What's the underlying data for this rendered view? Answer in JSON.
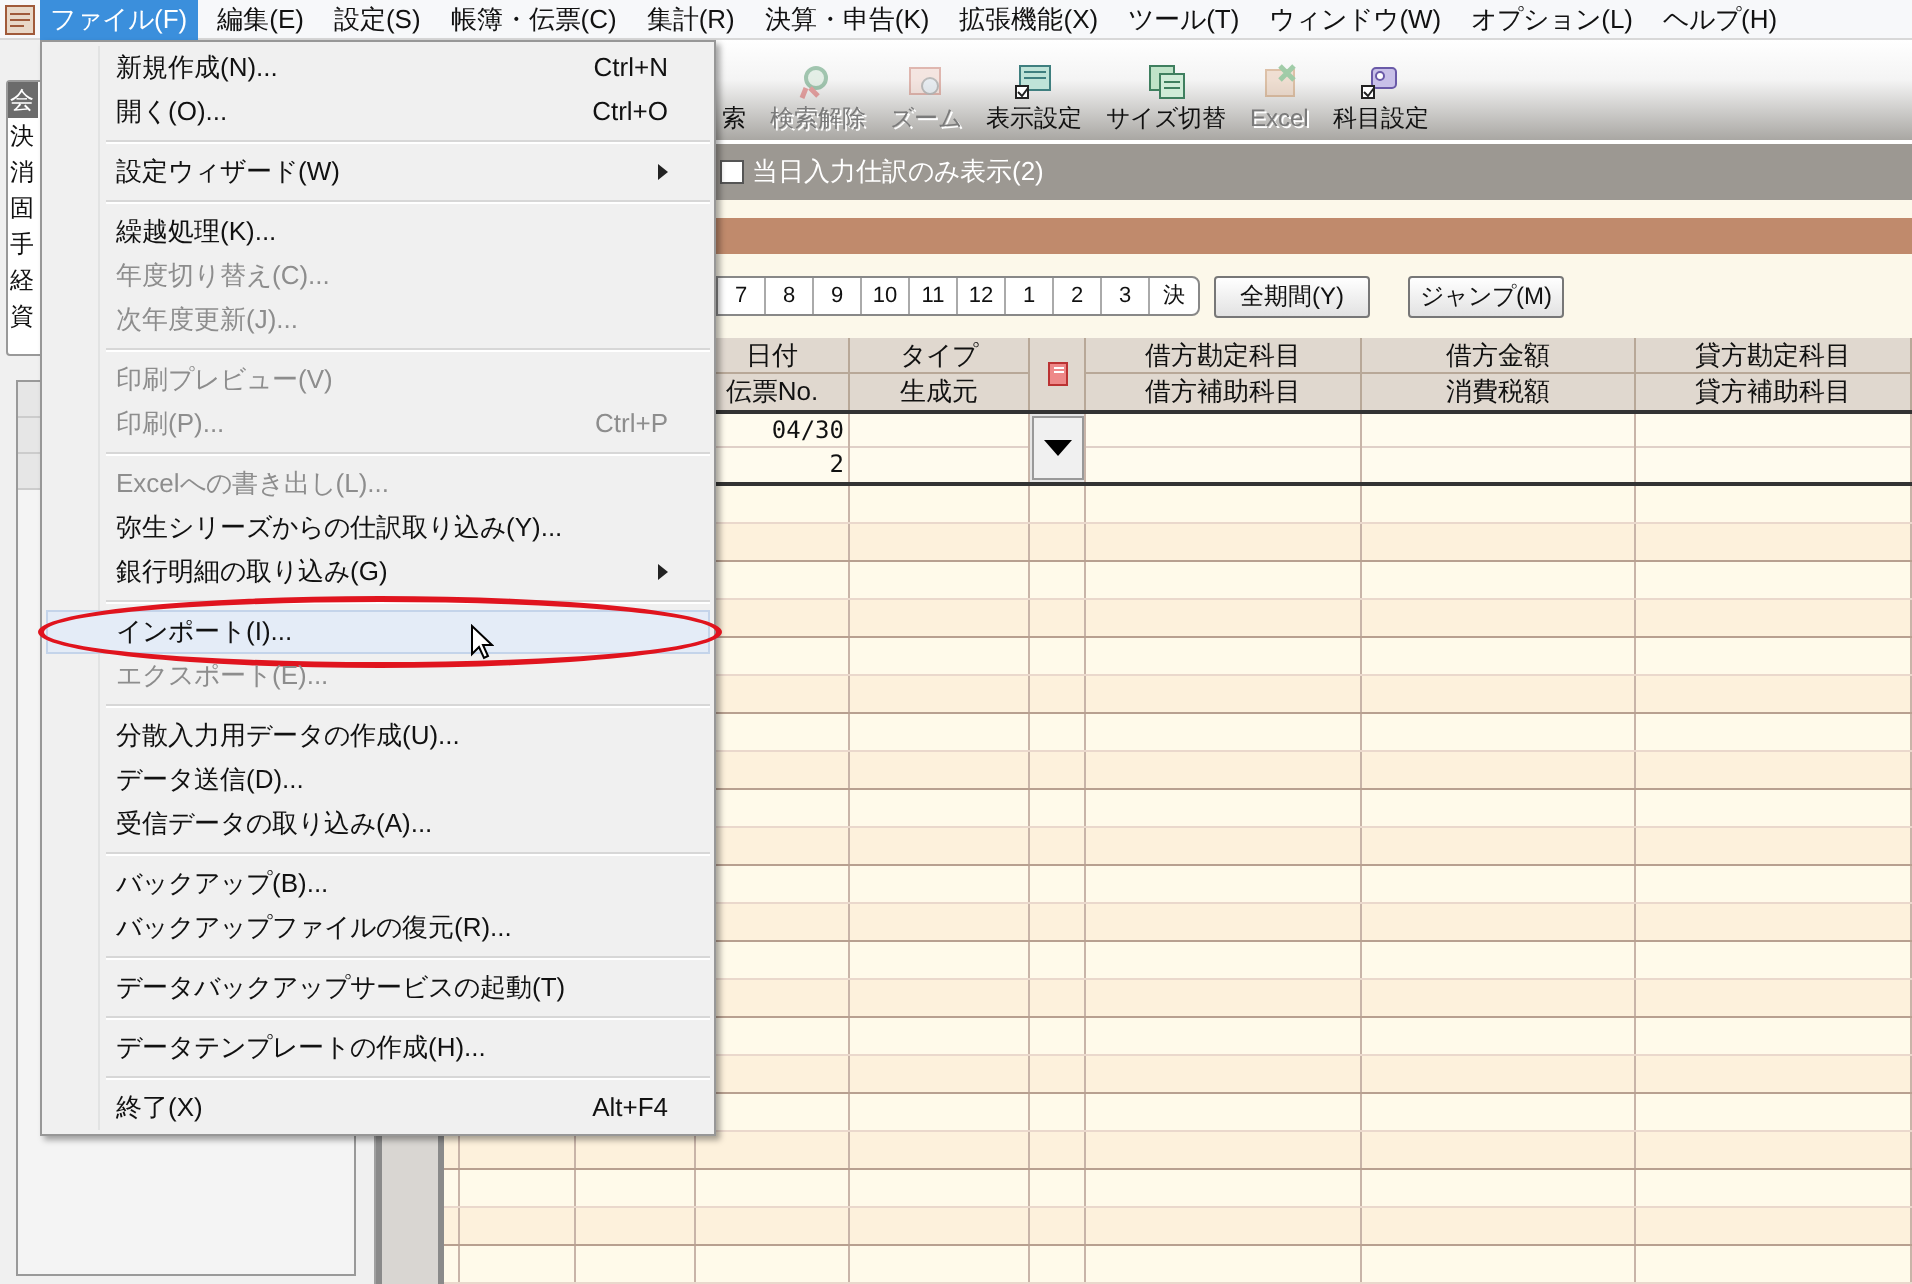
{
  "menu_bar": [
    {
      "label": "ファイル(F)",
      "selected": true
    },
    {
      "label": "編集(E)",
      "selected": false
    },
    {
      "label": "設定(S)",
      "selected": false
    },
    {
      "label": "帳簿・伝票(C)",
      "selected": false
    },
    {
      "label": "集計(R)",
      "selected": false
    },
    {
      "label": "決算・申告(K)",
      "selected": false
    },
    {
      "label": "拡張機能(X)",
      "selected": false
    },
    {
      "label": "ツール(T)",
      "selected": false
    },
    {
      "label": "ウィンドウ(W)",
      "selected": false
    },
    {
      "label": "オプション(L)",
      "selected": false
    },
    {
      "label": "ヘルプ(H)",
      "selected": false
    }
  ],
  "file_menu": {
    "groups": [
      {
        "items": [
          {
            "label": "新規作成(N)...",
            "shortcut": "Ctrl+N",
            "disabled": false,
            "submenu": false,
            "selected": false
          },
          {
            "label": "開く(O)...",
            "shortcut": "Ctrl+O",
            "disabled": false,
            "submenu": false,
            "selected": false
          }
        ]
      },
      {
        "items": [
          {
            "label": "設定ウィザード(W)",
            "disabled": false,
            "submenu": true,
            "selected": false
          }
        ]
      },
      {
        "items": [
          {
            "label": "繰越処理(K)...",
            "disabled": false,
            "submenu": false,
            "selected": false
          },
          {
            "label": "年度切り替え(C)...",
            "disabled": true,
            "submenu": false,
            "selected": false
          },
          {
            "label": "次年度更新(J)...",
            "disabled": true,
            "submenu": false,
            "selected": false
          }
        ]
      },
      {
        "items": [
          {
            "label": "印刷プレビュー(V)",
            "disabled": true,
            "submenu": false,
            "selected": false
          },
          {
            "label": "印刷(P)...",
            "shortcut": "Ctrl+P",
            "disabled": true,
            "submenu": false,
            "selected": false
          }
        ]
      },
      {
        "items": [
          {
            "label": "Excelへの書き出し(L)...",
            "disabled": true,
            "submenu": false,
            "selected": false
          },
          {
            "label": "弥生シリーズからの仕訳取り込み(Y)...",
            "disabled": false,
            "submenu": false,
            "selected": false
          },
          {
            "label": "銀行明細の取り込み(G)",
            "disabled": false,
            "submenu": true,
            "selected": false
          }
        ]
      },
      {
        "items": [
          {
            "label": "インポート(I)...",
            "disabled": false,
            "submenu": false,
            "selected": true
          },
          {
            "label": "エクスポート(E)...",
            "disabled": true,
            "submenu": false,
            "selected": false
          }
        ]
      },
      {
        "items": [
          {
            "label": "分散入力用データの作成(U)...",
            "disabled": false,
            "submenu": false,
            "selected": false
          },
          {
            "label": "データ送信(D)...",
            "disabled": false,
            "submenu": false,
            "selected": false
          },
          {
            "label": "受信データの取り込み(A)...",
            "disabled": false,
            "submenu": false,
            "selected": false
          }
        ]
      },
      {
        "items": [
          {
            "label": "バックアップ(B)...",
            "disabled": false,
            "submenu": false,
            "selected": false
          },
          {
            "label": "バックアップファイルの復元(R)...",
            "disabled": false,
            "submenu": false,
            "selected": false
          }
        ]
      },
      {
        "items": [
          {
            "label": "データバックアップサービスの起動(T)",
            "disabled": false,
            "submenu": false,
            "selected": false
          }
        ]
      },
      {
        "items": [
          {
            "label": "データテンプレートの作成(H)...",
            "disabled": false,
            "submenu": false,
            "selected": false
          }
        ]
      },
      {
        "items": [
          {
            "label": "終了(X)",
            "shortcut": "Alt+F4",
            "disabled": false,
            "submenu": false,
            "selected": false
          }
        ]
      }
    ]
  },
  "sidebar_tabs": [
    {
      "label": "会",
      "selected": true
    },
    {
      "label": "決",
      "selected": false
    },
    {
      "label": "消",
      "selected": false
    },
    {
      "label": "固",
      "selected": false
    },
    {
      "label": "手",
      "selected": false
    },
    {
      "label": "経",
      "selected": false
    },
    {
      "label": "資",
      "selected": false
    }
  ],
  "toolbar": [
    {
      "label": "索",
      "disabled": false
    },
    {
      "label": "検索解除",
      "disabled": true
    },
    {
      "label": "ズーム",
      "disabled": true
    },
    {
      "label": "表示設定",
      "disabled": false
    },
    {
      "label": "サイズ切替",
      "disabled": false
    },
    {
      "label": "Excel",
      "disabled": true
    },
    {
      "label": "科目設定",
      "disabled": false
    }
  ],
  "filter_checkbox": {
    "label": "当日入力仕訳のみ表示(2)",
    "checked": false
  },
  "month_buttons": [
    "7",
    "8",
    "9",
    "10",
    "11",
    "12",
    "1",
    "2",
    "3",
    "決"
  ],
  "period_buttons": [
    "全期間(Y)",
    "ジャンプ(M)"
  ],
  "table": {
    "columns": [
      {
        "kind": "text",
        "top": "日付",
        "bottom": "伝票No."
      },
      {
        "kind": "text",
        "top": "タイプ",
        "bottom": "生成元"
      },
      {
        "kind": "icon"
      },
      {
        "kind": "text",
        "top": "借方勘定科目",
        "bottom": "借方補助科目"
      },
      {
        "kind": "text",
        "top": "借方金額",
        "bottom": "消費税額"
      },
      {
        "kind": "text",
        "top": "貸方勘定科目",
        "bottom": "貸方補助科目"
      }
    ],
    "entries": [
      {
        "date": "04/30",
        "voucher_no": "2"
      }
    ]
  }
}
